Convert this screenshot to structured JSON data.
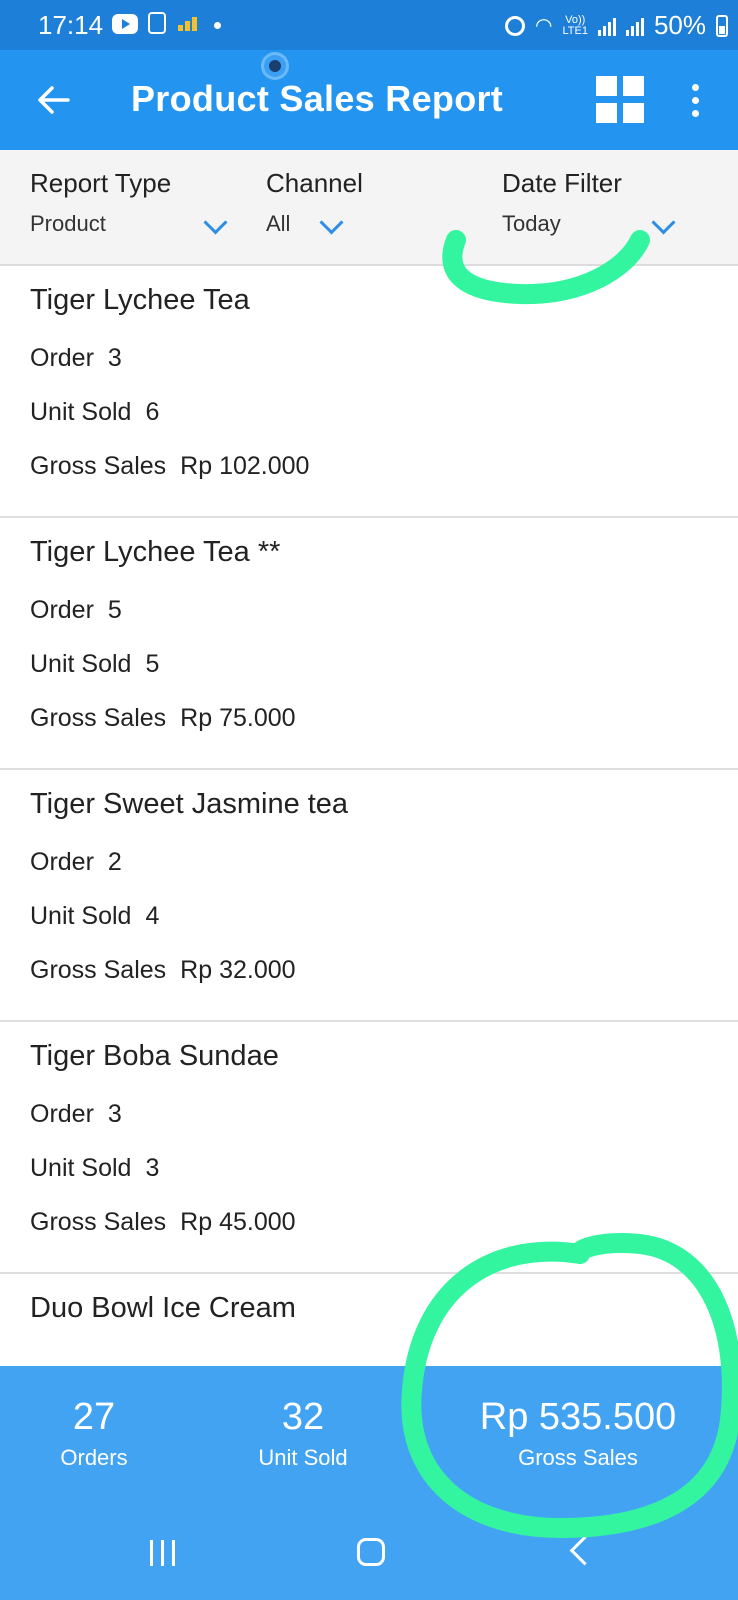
{
  "status_bar": {
    "time": "17:14",
    "battery": "50%",
    "network": "LTE1",
    "volte": "Vo))"
  },
  "app_bar": {
    "title": "Product Sales Report"
  },
  "filters": [
    {
      "label": "Report Type",
      "value": "Product"
    },
    {
      "label": "Channel",
      "value": "All"
    },
    {
      "label": "Date Filter",
      "value": "Today"
    }
  ],
  "products": [
    {
      "name": "Tiger Lychee Tea",
      "order_label": "Order",
      "order": "3",
      "unit_label": "Unit Sold",
      "unit": "6",
      "gross_label": "Gross Sales",
      "gross": "Rp 102.000"
    },
    {
      "name": "Tiger Lychee Tea **",
      "order_label": "Order",
      "order": "5",
      "unit_label": "Unit Sold",
      "unit": "5",
      "gross_label": "Gross Sales",
      "gross": "Rp 75.000"
    },
    {
      "name": "Tiger Sweet Jasmine tea",
      "order_label": "Order",
      "order": "2",
      "unit_label": "Unit Sold",
      "unit": "4",
      "gross_label": "Gross Sales",
      "gross": "Rp 32.000"
    },
    {
      "name": "Tiger Boba Sundae",
      "order_label": "Order",
      "order": "3",
      "unit_label": "Unit Sold",
      "unit": "3",
      "gross_label": "Gross Sales",
      "gross": "Rp 45.000"
    },
    {
      "name": "Duo Bowl Ice Cream"
    }
  ],
  "summary": {
    "orders": {
      "value": "27",
      "caption": "Orders"
    },
    "units": {
      "value": "32",
      "caption": "Unit Sold"
    },
    "gross": {
      "value": "Rp 535.500",
      "caption": "Gross Sales"
    }
  },
  "colors": {
    "status_bar": "#1e7fd8",
    "app_bar": "#2394f0",
    "summary": "#42a3f3",
    "accent": "#2e8ee6",
    "annotation": "#33f5a0"
  }
}
